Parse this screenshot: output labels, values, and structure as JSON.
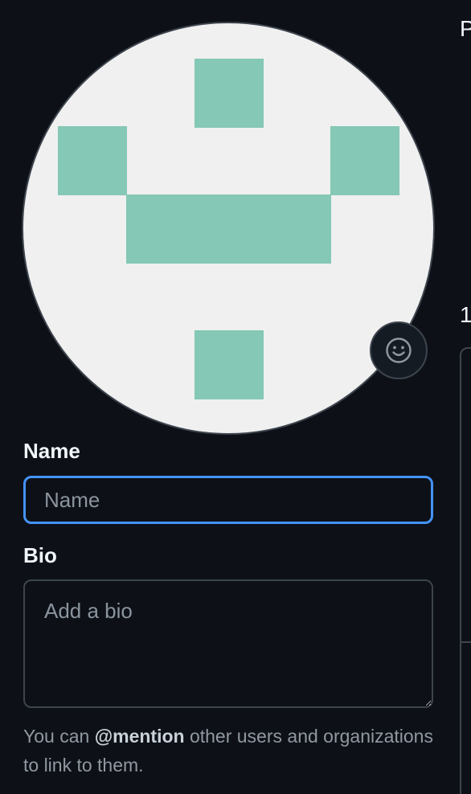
{
  "profile": {
    "avatar": {
      "alt": "Profile picture",
      "identicon_bg": "#f0f0f0",
      "identicon_fg": "#84c8b5"
    },
    "emoji_button_icon": "smiley-icon",
    "name_label": "Name",
    "name_placeholder": "Name",
    "name_value": "",
    "bio_label": "Bio",
    "bio_placeholder": "Add a bio",
    "bio_value": "",
    "hint_prefix": "You can ",
    "hint_mention": "@mention",
    "hint_suffix": " other users and organizations to link to them."
  },
  "right_column": {
    "heading_fragment": "P",
    "number_fragment": "1"
  },
  "colors": {
    "background": "#0d1117",
    "focus_border": "#4493f8",
    "border": "#3d444d",
    "muted_text": "#9198a1"
  }
}
